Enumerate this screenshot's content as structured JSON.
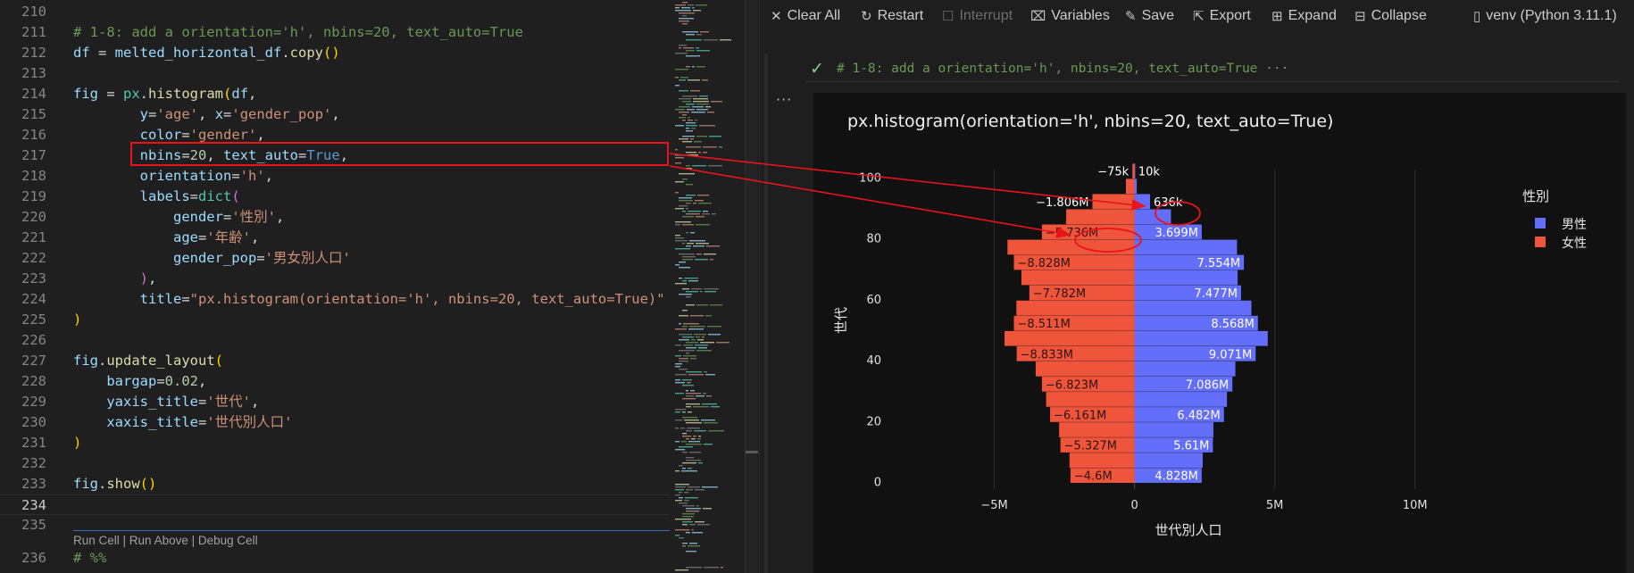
{
  "editor": {
    "lines": [
      {
        "n": "210",
        "tokens": []
      },
      {
        "n": "211",
        "tokens": [
          {
            "t": "# 1-8: add a orientation='h', nbins=20, text_auto=True",
            "c": "t-cm"
          }
        ]
      },
      {
        "n": "212",
        "tokens": [
          {
            "t": "df",
            "c": "t-var"
          },
          {
            "t": " = ",
            "c": "t-op"
          },
          {
            "t": "melted_horizontal_df",
            "c": "t-var"
          },
          {
            "t": ".",
            "c": "t-op"
          },
          {
            "t": "copy",
            "c": "t-fn"
          },
          {
            "t": "()",
            "c": "t-p1"
          }
        ]
      },
      {
        "n": "213",
        "tokens": []
      },
      {
        "n": "214",
        "tokens": [
          {
            "t": "fig",
            "c": "t-var"
          },
          {
            "t": " = ",
            "c": "t-op"
          },
          {
            "t": "px",
            "c": "t-cls"
          },
          {
            "t": ".",
            "c": "t-op"
          },
          {
            "t": "histogram",
            "c": "t-fn"
          },
          {
            "t": "(",
            "c": "t-p1"
          },
          {
            "t": "df",
            "c": "t-var"
          },
          {
            "t": ",",
            "c": "t-op"
          }
        ]
      },
      {
        "n": "215",
        "tokens": [
          {
            "t": "        ",
            "c": "t-op"
          },
          {
            "t": "y",
            "c": "t-var"
          },
          {
            "t": "=",
            "c": "t-op"
          },
          {
            "t": "'age'",
            "c": "t-str"
          },
          {
            "t": ", ",
            "c": "t-op"
          },
          {
            "t": "x",
            "c": "t-var"
          },
          {
            "t": "=",
            "c": "t-op"
          },
          {
            "t": "'gender_pop'",
            "c": "t-str"
          },
          {
            "t": ",",
            "c": "t-op"
          }
        ]
      },
      {
        "n": "216",
        "tokens": [
          {
            "t": "        ",
            "c": "t-op"
          },
          {
            "t": "color",
            "c": "t-var"
          },
          {
            "t": "=",
            "c": "t-op"
          },
          {
            "t": "'gender'",
            "c": "t-str"
          },
          {
            "t": ",",
            "c": "t-op"
          }
        ]
      },
      {
        "n": "217",
        "tokens": [
          {
            "t": "        ",
            "c": "t-op"
          },
          {
            "t": "nbins",
            "c": "t-var"
          },
          {
            "t": "=",
            "c": "t-op"
          },
          {
            "t": "20",
            "c": "t-num"
          },
          {
            "t": ", ",
            "c": "t-op"
          },
          {
            "t": "text_auto",
            "c": "t-var"
          },
          {
            "t": "=",
            "c": "t-op"
          },
          {
            "t": "True",
            "c": "t-kw"
          },
          {
            "t": ",",
            "c": "t-op"
          }
        ]
      },
      {
        "n": "218",
        "tokens": [
          {
            "t": "        ",
            "c": "t-op"
          },
          {
            "t": "orientation",
            "c": "t-var"
          },
          {
            "t": "=",
            "c": "t-op"
          },
          {
            "t": "'h'",
            "c": "t-str"
          },
          {
            "t": ",",
            "c": "t-op"
          }
        ]
      },
      {
        "n": "219",
        "tokens": [
          {
            "t": "        ",
            "c": "t-op"
          },
          {
            "t": "labels",
            "c": "t-var"
          },
          {
            "t": "=",
            "c": "t-op"
          },
          {
            "t": "dict",
            "c": "t-cls"
          },
          {
            "t": "(",
            "c": "t-p2"
          }
        ]
      },
      {
        "n": "220",
        "tokens": [
          {
            "t": "            ",
            "c": "t-op"
          },
          {
            "t": "gender",
            "c": "t-var"
          },
          {
            "t": "=",
            "c": "t-op"
          },
          {
            "t": "'性別'",
            "c": "t-str"
          },
          {
            "t": ",",
            "c": "t-op"
          }
        ]
      },
      {
        "n": "221",
        "tokens": [
          {
            "t": "            ",
            "c": "t-op"
          },
          {
            "t": "age",
            "c": "t-var"
          },
          {
            "t": "=",
            "c": "t-op"
          },
          {
            "t": "'年齢'",
            "c": "t-str"
          },
          {
            "t": ",",
            "c": "t-op"
          }
        ]
      },
      {
        "n": "222",
        "tokens": [
          {
            "t": "            ",
            "c": "t-op"
          },
          {
            "t": "gender_pop",
            "c": "t-var"
          },
          {
            "t": "=",
            "c": "t-op"
          },
          {
            "t": "'男女別人口'",
            "c": "t-str"
          }
        ]
      },
      {
        "n": "223",
        "tokens": [
          {
            "t": "        ",
            "c": "t-op"
          },
          {
            "t": ")",
            "c": "t-p2"
          },
          {
            "t": ",",
            "c": "t-op"
          }
        ]
      },
      {
        "n": "224",
        "tokens": [
          {
            "t": "        ",
            "c": "t-op"
          },
          {
            "t": "title",
            "c": "t-var"
          },
          {
            "t": "=",
            "c": "t-op"
          },
          {
            "t": "\"px.histogram(orientation='h', nbins=20, text_auto=True)\"",
            "c": "t-str"
          }
        ]
      },
      {
        "n": "225",
        "tokens": [
          {
            "t": ")",
            "c": "t-p1"
          }
        ]
      },
      {
        "n": "226",
        "tokens": []
      },
      {
        "n": "227",
        "tokens": [
          {
            "t": "fig",
            "c": "t-var"
          },
          {
            "t": ".",
            "c": "t-op"
          },
          {
            "t": "update_layout",
            "c": "t-fn"
          },
          {
            "t": "(",
            "c": "t-p1"
          }
        ]
      },
      {
        "n": "228",
        "tokens": [
          {
            "t": "    ",
            "c": "t-op"
          },
          {
            "t": "bargap",
            "c": "t-var"
          },
          {
            "t": "=",
            "c": "t-op"
          },
          {
            "t": "0.02",
            "c": "t-num"
          },
          {
            "t": ",",
            "c": "t-op"
          }
        ]
      },
      {
        "n": "229",
        "tokens": [
          {
            "t": "    ",
            "c": "t-op"
          },
          {
            "t": "yaxis_title",
            "c": "t-var"
          },
          {
            "t": "=",
            "c": "t-op"
          },
          {
            "t": "'世代'",
            "c": "t-str"
          },
          {
            "t": ",",
            "c": "t-op"
          }
        ]
      },
      {
        "n": "230",
        "tokens": [
          {
            "t": "    ",
            "c": "t-op"
          },
          {
            "t": "xaxis_title",
            "c": "t-var"
          },
          {
            "t": "=",
            "c": "t-op"
          },
          {
            "t": "'世代別人口'",
            "c": "t-str"
          }
        ]
      },
      {
        "n": "231",
        "tokens": [
          {
            "t": ")",
            "c": "t-p1"
          }
        ]
      },
      {
        "n": "232",
        "tokens": []
      },
      {
        "n": "233",
        "tokens": [
          {
            "t": "fig",
            "c": "t-var"
          },
          {
            "t": ".",
            "c": "t-op"
          },
          {
            "t": "show",
            "c": "t-fn"
          },
          {
            "t": "()",
            "c": "t-p1"
          }
        ]
      },
      {
        "n": "234",
        "tokens": []
      },
      {
        "n": "235",
        "tokens": []
      },
      {
        "n": "236",
        "tokens": [
          {
            "t": "# %%",
            "c": "t-cm"
          }
        ]
      }
    ],
    "codelens": {
      "run_cell": "Run Cell",
      "run_above": "Run Above",
      "debug_cell": "Debug Cell",
      "sep": " | "
    }
  },
  "toolbar": {
    "clear_all": "Clear All",
    "restart": "Restart",
    "interrupt": "Interrupt",
    "variables": "Variables",
    "save": "Save",
    "export": "Export",
    "expand": "Expand",
    "collapse": "Collapse",
    "kernel": "venv (Python 3.11.1)"
  },
  "cell": {
    "summary": "# 1-8: add a orientation='h', nbins=20, text_auto=True",
    "ellipsis": "···",
    "more": "···"
  },
  "chart_data": {
    "type": "bar",
    "orientation": "horizontal",
    "title": "px.histogram(orientation='h', nbins=20, text_auto=True)",
    "xlabel": "世代別人口",
    "ylabel": "世代",
    "legend_title": "性別",
    "legend_position": "top-right",
    "grid": true,
    "xlim": [
      -8900000,
      10200000
    ],
    "ylim": [
      -2.5,
      102.5
    ],
    "x_ticks": [
      -5000000,
      0,
      5000000,
      10000000
    ],
    "x_tick_labels": [
      "−5M",
      "0",
      "5M",
      "10M"
    ],
    "y_ticks": [
      0,
      20,
      40,
      60,
      80,
      100
    ],
    "y_tick_labels": [
      "0",
      "20",
      "40",
      "60",
      "80",
      "100"
    ],
    "bin_centers": [
      2,
      7,
      12,
      17,
      22,
      27,
      32,
      37,
      42,
      47,
      52,
      57,
      62,
      67,
      72,
      77,
      82,
      87,
      92,
      97,
      102
    ],
    "series": [
      {
        "name": "男性",
        "color": "#636efa",
        "values": [
          2396000,
          2432000,
          2796000,
          2814000,
          3190000,
          3296000,
          3490000,
          3596000,
          4320000,
          4751000,
          4400000,
          4168000,
          3800000,
          3677000,
          3900000,
          3654000,
          2399000,
          1300000,
          555000,
          81000,
          10000
        ],
        "labels": [
          "4.828M",
          "5.61M",
          "6.482M",
          "7.086M",
          "9.071M",
          "8.568M",
          "7.477M",
          "7.554M",
          "3.699M",
          "636k",
          "10k"
        ]
      },
      {
        "name": "女性",
        "color": "#ef553b",
        "values": [
          -2282000,
          -2318000,
          -2640000,
          -2687000,
          -3010000,
          -3151000,
          -3300000,
          -3523000,
          -4200000,
          -4633000,
          -4300000,
          -4211000,
          -3750000,
          -4032000,
          -4300000,
          -4528000,
          -3300000,
          -2436000,
          -1500000,
          -306000,
          -75000
        ],
        "labels": [
          "−4.6M",
          "−5.327M",
          "−6.161M",
          "−6.823M",
          "−8.833M",
          "−8.511M",
          "−7.782M",
          "−8.828M",
          "−5.736M",
          "−1.806M",
          "−75k"
        ]
      }
    ]
  }
}
